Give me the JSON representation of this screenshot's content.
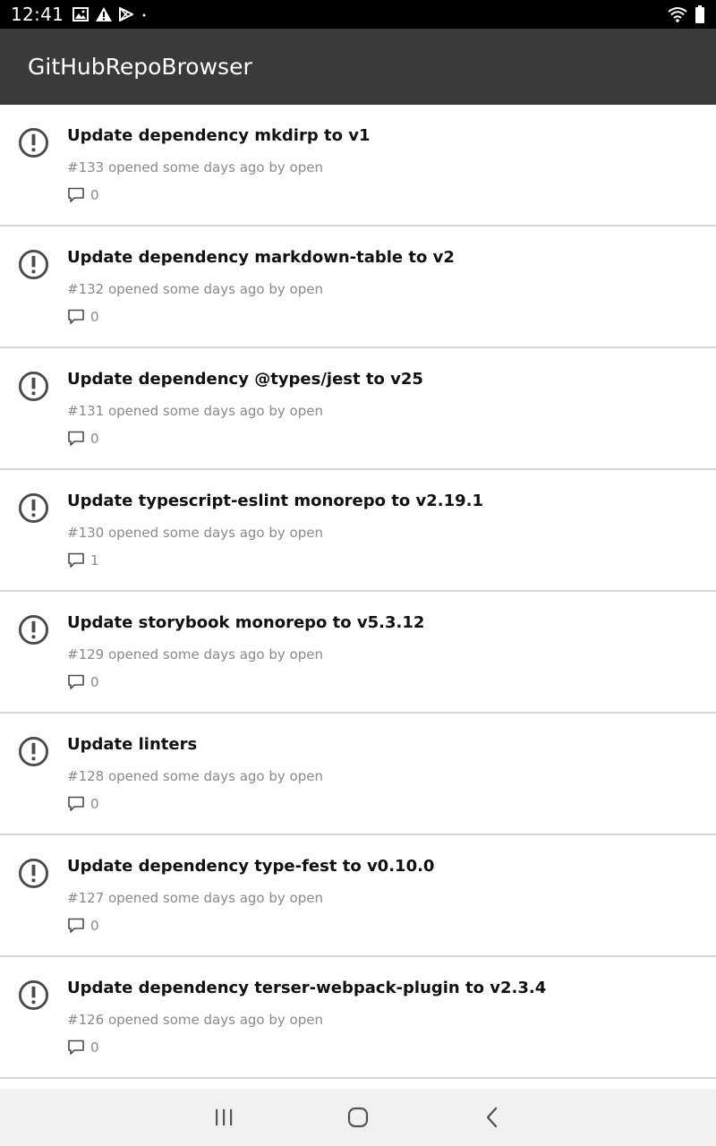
{
  "status_bar": {
    "time": "12:41",
    "left_icons": [
      "image-icon",
      "warning-icon",
      "play-store-icon",
      "dot-icon"
    ],
    "right_icons": [
      "wifi-icon",
      "battery-icon"
    ]
  },
  "app_bar": {
    "title": "GitHubRepoBrowser"
  },
  "issues": [
    {
      "title": "Update dependency mkdirp to v1",
      "meta": "#133 opened some days ago by open",
      "comments": "0"
    },
    {
      "title": "Update dependency markdown-table to v2",
      "meta": "#132 opened some days ago by open",
      "comments": "0"
    },
    {
      "title": "Update dependency @types/jest to v25",
      "meta": "#131 opened some days ago by open",
      "comments": "0"
    },
    {
      "title": "Update typescript-eslint monorepo to v2.19.1",
      "meta": "#130 opened some days ago by open",
      "comments": "1"
    },
    {
      "title": "Update storybook monorepo to v5.3.12",
      "meta": "#129 opened some days ago by open",
      "comments": "0"
    },
    {
      "title": "Update linters",
      "meta": "#128 opened some days ago by open",
      "comments": "0"
    },
    {
      "title": "Update dependency type-fest to v0.10.0",
      "meta": "#127 opened some days ago by open",
      "comments": "0"
    },
    {
      "title": "Update dependency terser-webpack-plugin to v2.3.4",
      "meta": "#126 opened some days ago by open",
      "comments": "0"
    }
  ],
  "nav_bar": {
    "buttons": [
      "recents-icon",
      "home-icon",
      "back-icon"
    ]
  },
  "colors": {
    "app_bar": "#3a3a3a",
    "status_bar": "#000000",
    "nav_bar": "#f1f1f1",
    "issue_icon": "#4a4a4a",
    "meta_text": "#8a8a8a"
  }
}
